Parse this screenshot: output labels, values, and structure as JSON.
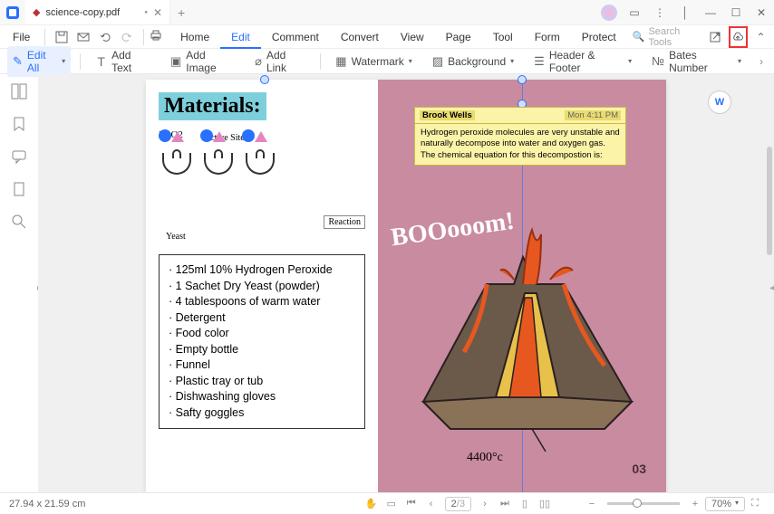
{
  "titlebar": {
    "tab_title": "science-copy.pdf",
    "tab_icon_color": "#bb3333"
  },
  "menu": {
    "file": "File",
    "tabs": [
      "Home",
      "Edit",
      "Comment",
      "Convert",
      "View",
      "Page",
      "Tool",
      "Form",
      "Protect"
    ],
    "active_tab": "Edit",
    "search_placeholder": "Search Tools"
  },
  "toolbar": {
    "edit_all": "Edit All",
    "add_text": "Add Text",
    "add_image": "Add Image",
    "add_link": "Add Link",
    "watermark": "Watermark",
    "background": "Background",
    "header_footer": "Header & Footer",
    "bates_number": "Bates Number"
  },
  "doc": {
    "materials_title": "Materials:",
    "diagram": {
      "h2o2": "H2O2",
      "active_site": "Active Site",
      "yeast": "Yeast",
      "reaction": "Reaction"
    },
    "materials_list": [
      "125ml 10% Hydrogen Peroxide",
      "1 Sachet Dry Yeast (powder)",
      "4 tablespoons of warm water",
      "Detergent",
      "Food color",
      "Empty bottle",
      "Funnel",
      "Plastic tray or tub",
      "Dishwashing gloves",
      "Safty goggles"
    ],
    "comment": {
      "author": "Brook Wells",
      "time": "Mon 4:11 PM",
      "body": "Hydrogen peroxide molecules are very unstable and naturally decompose into water and oxygen gas. The chemical equation for this decompostion is:"
    },
    "boom": "BOOooom!",
    "temp": "4400°c",
    "page_num": "03"
  },
  "status": {
    "dimensions": "27.94 x 21.59 cm",
    "page": "2",
    "pages": "/3",
    "zoom": "70%"
  }
}
